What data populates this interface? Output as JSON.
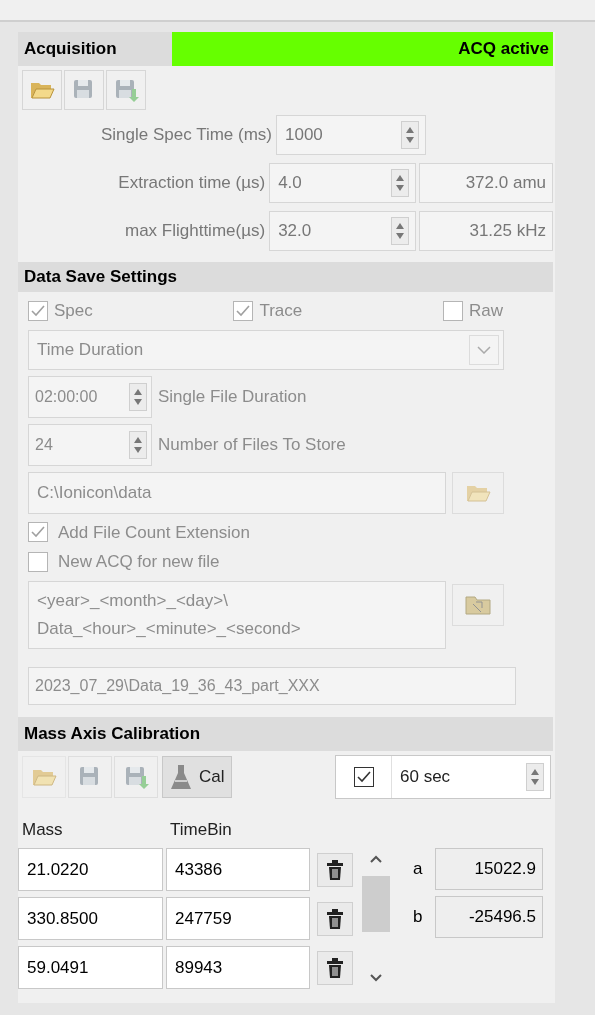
{
  "acquisition": {
    "title": "Acquisition",
    "status": "ACQ active",
    "active": true,
    "fields": [
      {
        "label": "Single Spec Time (ms)",
        "value": "1000"
      },
      {
        "label": "Extraction time (µs)",
        "value": "4.0",
        "readout": "372.0 amu"
      },
      {
        "label": "max Flighttime(µs)",
        "value": "32.0",
        "readout": "31.25 kHz"
      }
    ]
  },
  "data_save": {
    "title": "Data Save Settings",
    "disabled": true,
    "checkboxes": [
      {
        "label": "Spec",
        "checked": true
      },
      {
        "label": "Trace",
        "checked": true
      },
      {
        "label": "Raw",
        "checked": false
      }
    ],
    "mode": "Time Duration",
    "spinners": [
      {
        "value": "02:00:00",
        "label": "Single File Duration"
      },
      {
        "value": "24",
        "label": "Number of Files To Store"
      }
    ],
    "path": "C:\\Ionicon\\data",
    "options": [
      {
        "label": "Add File Count Extension",
        "checked": true
      },
      {
        "label": "New ACQ for new file",
        "checked": false
      }
    ],
    "template_lines": [
      "<year>_<month>_<day>\\",
      "Data_<hour>_<minute>_<second>"
    ],
    "preview": "2023_07_29\\Data_19_36_43_part_XXX"
  },
  "calibration": {
    "title": "Mass Axis Calibration",
    "cal_button": "Cal",
    "auto": {
      "checked": true,
      "value": "60 sec"
    },
    "columns": [
      "Mass",
      "TimeBin"
    ],
    "rows": [
      {
        "mass": "21.0220",
        "timebin": "43386"
      },
      {
        "mass": "330.8500",
        "timebin": "247759"
      },
      {
        "mass": "59.0491",
        "timebin": "89943"
      }
    ],
    "coefficients": [
      {
        "name": "a",
        "value": "15022.9"
      },
      {
        "name": "b",
        "value": "-25496.5"
      }
    ]
  }
}
